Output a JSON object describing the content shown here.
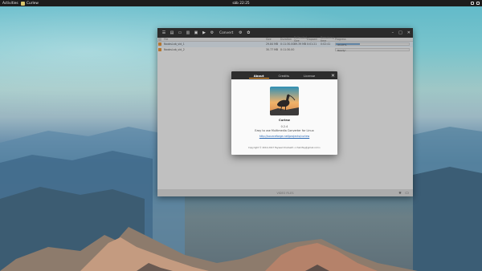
{
  "topbar": {
    "activities": "Activities",
    "app_name": "Curlew",
    "clock": "sáb 22:25"
  },
  "app": {
    "toolbar": {
      "convert_label": "Convert",
      "icons": [
        "menu-icon",
        "add-file-icon",
        "add-folder-icon",
        "remove-icon",
        "clear-icon",
        "play-icon",
        "convert-icon",
        "settings-icon",
        "about-icon"
      ]
    },
    "columns": [
      "File",
      "Size",
      "Duration",
      "Estimated Size",
      "Elapsed",
      "Remaining time",
      "Progress"
    ],
    "rows": [
      {
        "file": "NoobsLab_vid_1",
        "size": "29.84 MB",
        "duration": "0:11:30.00",
        "est_size": "89.39 MB",
        "elapsed": "0:01:21",
        "remaining": "0:02:41",
        "progress_text": "33.07%",
        "progress": 0.33
      },
      {
        "file": "NoobsLab_vid_2",
        "size": "30.77 MB",
        "duration": "0:11:30.00",
        "est_size": "",
        "elapsed": "",
        "remaining": "",
        "progress_text": "Ready!",
        "progress": 0
      }
    ],
    "status_text": "VIDEO FILES"
  },
  "about": {
    "tabs": [
      {
        "label": "About",
        "active": true
      },
      {
        "label": "Credits",
        "active": false
      },
      {
        "label": "License",
        "active": false
      }
    ],
    "app_name": "Curlew",
    "version": "0.2.4",
    "description": "Easy to use Multimedia Converter for Linux",
    "url": "http://sourceforge.net/projects/curlew",
    "copyright": "Copyright © 2012-2017 Fayssal Chamekh <chamfay@gmail.com>"
  },
  "colors": {
    "accent": "#e8932a",
    "header_dark": "#2b2b2b",
    "progress_fill": "#6fa1cf"
  }
}
